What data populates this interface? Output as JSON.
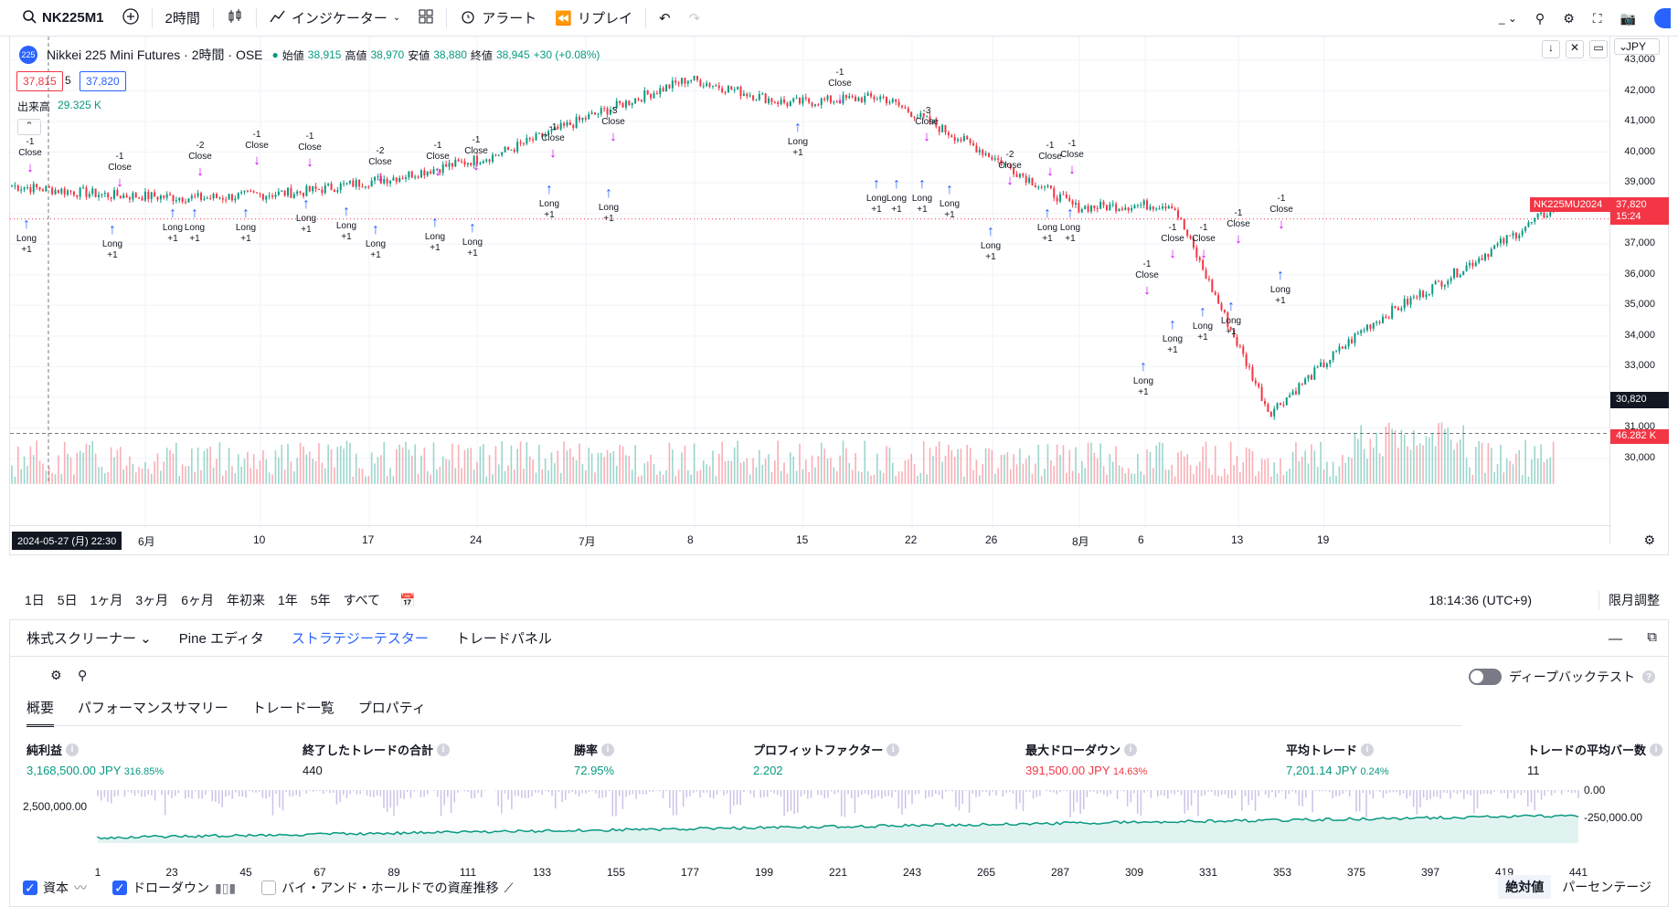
{
  "toolbar": {
    "symbol": "NK225M1",
    "timeframe": "2時間",
    "indicators": "インジケーター",
    "alert": "アラート",
    "replay": "リプレイ"
  },
  "legend": {
    "title": "Nikkei 225 Mini Futures · 2時間 · OSE",
    "open_label": "始値",
    "open": "38,915",
    "high_label": "高値",
    "high": "38,970",
    "low_label": "安値",
    "low": "38,880",
    "close_label": "終値",
    "close": "38,945",
    "change": "+30 (+0.08%)",
    "bid": "37,815",
    "spread": "5",
    "ask": "37,820",
    "volume_label": "出来高",
    "volume": "29.325 K",
    "currency": "JPY"
  },
  "price_axis": {
    "ticks": [
      "43,000",
      "42,000",
      "41,000",
      "40,000",
      "39,000",
      "38,000",
      "37,000",
      "36,000",
      "35,000",
      "34,000",
      "33,000",
      "32,000",
      "31,000",
      "30,000"
    ],
    "last_label": "NK225MU2024",
    "last_price": "37,820",
    "countdown": "15:24",
    "crosshair_price": "30,820",
    "volume_last": "46.282 K"
  },
  "time_axis": {
    "crosshair": "2024-05-27 (月)  22:30",
    "labels": [
      "6月",
      "10",
      "17",
      "24",
      "7月",
      "8",
      "15",
      "22",
      "26",
      "8月",
      "6",
      "13",
      "19"
    ]
  },
  "trade_labels": {
    "long": "Long",
    "close": "Close",
    "plus": "+1",
    "minus": "-1",
    "minus2": "-2",
    "minus3": "-3"
  },
  "chart_data": {
    "type": "candlestick",
    "description": "NK225M1 2-hour candles, late May to Aug 2024",
    "ylim": [
      30000,
      43000
    ],
    "x": [
      "5/27",
      "6/3",
      "6/10",
      "6/17",
      "6/24",
      "7/1",
      "7/8",
      "7/11",
      "7/15",
      "7/18",
      "7/22",
      "7/26",
      "8/1",
      "8/5",
      "8/6",
      "8/13",
      "8/19"
    ],
    "close": [
      38900,
      38600,
      38500,
      38700,
      39200,
      39900,
      41200,
      42400,
      41600,
      41800,
      40100,
      38200,
      38300,
      31500,
      34300,
      36200,
      38300
    ]
  },
  "range": {
    "items": [
      "1日",
      "5日",
      "1ヶ月",
      "3ヶ月",
      "6ヶ月",
      "年初来",
      "1年",
      "5年",
      "すべて"
    ],
    "clock": "18:14:36 (UTC+9)",
    "adjust": "限月調整"
  },
  "panel": {
    "tabs": [
      "株式スクリーナー",
      "Pine エディタ",
      "ストラテジーテスター",
      "トレードパネル"
    ],
    "deep": "ディープバックテスト",
    "subtabs": [
      "概要",
      "パフォーマンスサマリー",
      "トレード一覧",
      "プロパティ"
    ]
  },
  "metrics": [
    {
      "label": "純利益",
      "value": "3,168,500.00 JPY",
      "pct": "316.85%"
    },
    {
      "label": "終了したトレードの合計",
      "value": "440",
      "pct": ""
    },
    {
      "label": "勝率",
      "value": "72.95%",
      "pct": ""
    },
    {
      "label": "プロフィットファクター",
      "value": "2.202",
      "pct": ""
    },
    {
      "label": "最大ドローダウン",
      "value": "391,500.00 JPY",
      "pct": "14.63%"
    },
    {
      "label": "平均トレード",
      "value": "7,201.14 JPY",
      "pct": "0.24%"
    },
    {
      "label": "トレードの平均バー数",
      "value": "11",
      "pct": ""
    }
  ],
  "equity": {
    "left_tick": "2,500,000.00",
    "right_top": "0.00",
    "right_bottom": "-250,000.00",
    "x": [
      "1",
      "23",
      "45",
      "67",
      "89",
      "111",
      "133",
      "155",
      "177",
      "199",
      "221",
      "243",
      "265",
      "287",
      "309",
      "331",
      "353",
      "375",
      "397",
      "419",
      "441"
    ]
  },
  "footer": {
    "equity": "資本",
    "drawdown": "ドローダウン",
    "buyhold": "バイ・アンド・ホールドでの資産推移",
    "absolute": "絶対値",
    "percent": "パーセンテージ"
  }
}
